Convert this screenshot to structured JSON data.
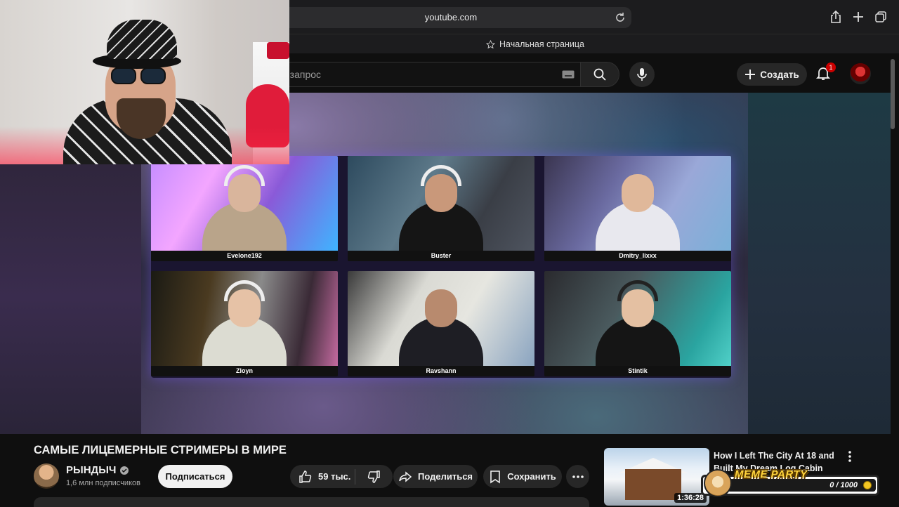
{
  "browser": {
    "url": "youtube.com",
    "bookmark_label": "Начальная страница"
  },
  "header": {
    "search_placeholder": "е запрос",
    "create_label": "Создать",
    "notification_count": "1"
  },
  "video": {
    "tiles": [
      {
        "name": "Evelone192"
      },
      {
        "name": "Buster"
      },
      {
        "name": "Dmitry_lixxx"
      },
      {
        "name": "Zloyn"
      },
      {
        "name": "Ravshann"
      },
      {
        "name": "Stintik"
      }
    ]
  },
  "info": {
    "title": "САМЫЕ ЛИЦЕМЕРНЫЕ СТРИМЕРЫ В МИРЕ",
    "channel_name": "РЫНДЫЧ",
    "subscribers": "1,6 млн подписчиков",
    "subscribe_label": "Подписаться",
    "likes": "59 тыс.",
    "share_label": "Поделиться",
    "save_label": "Сохранить"
  },
  "recommendation": {
    "title": "How I Left The City At 18 and Built My Dream Log Cabin",
    "duration": "1:36:28"
  },
  "meme_party": {
    "logo": "MEME PARTY",
    "count": "0 / 1000"
  },
  "colors": {
    "youtube_bg": "#0f0f0f",
    "pill_bg": "#272727",
    "badge_red": "#cc0000",
    "grid_glow": "#785aff"
  }
}
